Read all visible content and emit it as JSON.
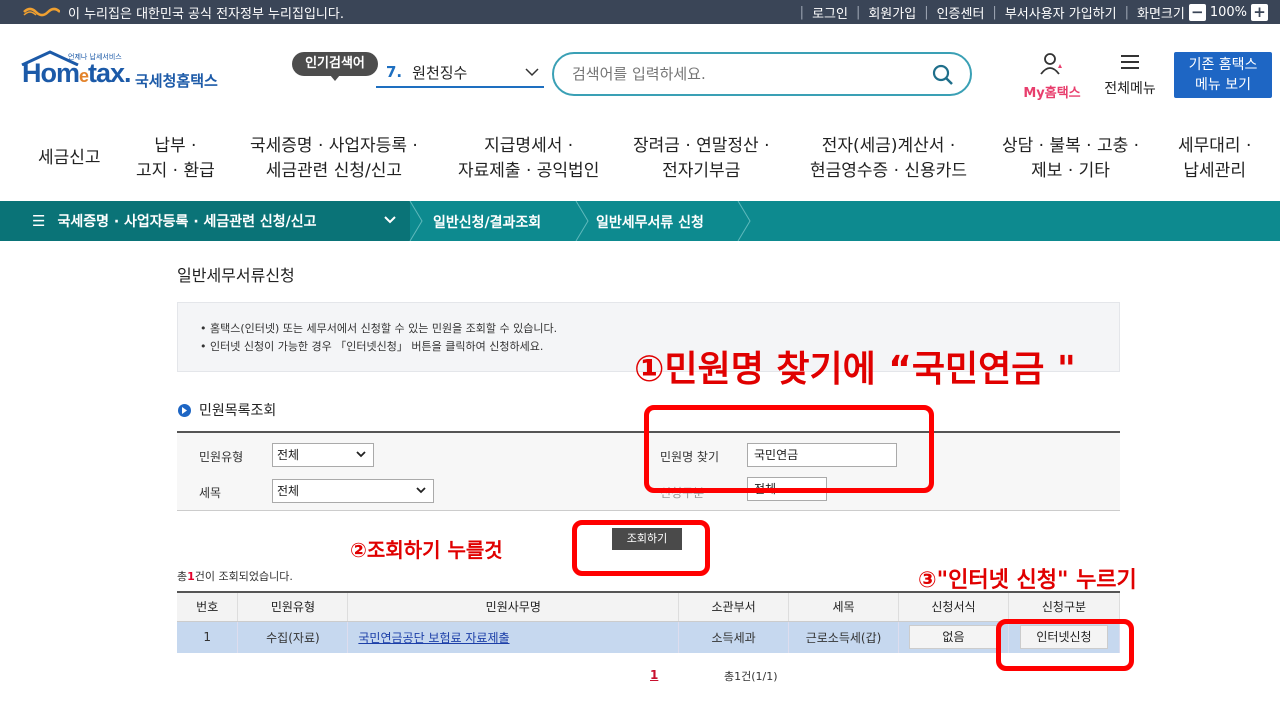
{
  "govbar": {
    "notice": "이 누리집은 대한민국 공식 전자정부 누리집입니다.",
    "links": [
      "로그인",
      "회원가입",
      "인증센터",
      "부서사용자 가입하기"
    ],
    "zoom_label": "화면크기",
    "zoom_value": "100%"
  },
  "header": {
    "logo_small": "언제나 납세서비스",
    "logo_home": "Hom",
    "logo_e": "e",
    "logo_tax": "tax.",
    "logo_nts": "국세청홈택스",
    "popular_badge": "인기검색어",
    "popular_num": "7.",
    "popular_term": "원천징수",
    "search_placeholder": "검색어를 입력하세요.",
    "my_hometax": "My홈택스",
    "all_menu": "전체메뉴",
    "old_menu_line1": "기존 홈택스",
    "old_menu_line2": "메뉴 보기"
  },
  "nav": [
    {
      "l1": "세금신고",
      "l2": ""
    },
    {
      "l1": "납부 ·",
      "l2": "고지 · 환급"
    },
    {
      "l1": "국세증명 · 사업자등록 ·",
      "l2": "세금관련 신청/신고"
    },
    {
      "l1": "지급명세서 ·",
      "l2": "자료제출 · 공익법인"
    },
    {
      "l1": "장려금 · 연말정산 ·",
      "l2": "전자기부금"
    },
    {
      "l1": "전자(세금)계산서 ·",
      "l2": "현금영수증 · 신용카드"
    },
    {
      "l1": "상담 · 불복 · 고충 ·",
      "l2": "제보 · 기타"
    },
    {
      "l1": "세무대리 ·",
      "l2": "납세관리"
    }
  ],
  "breadcrumb": {
    "c1": "국세증명 · 사업자등록 · 세금관련 신청/신고",
    "c2": "일반신청/결과조회",
    "c3": "일반세무서류 신청"
  },
  "content": {
    "title": "일반세무서류신청",
    "info1": "• 홈택스(인터넷) 또는 세무서에서 신청할 수 있는 민원을 조회할 수 있습니다.",
    "info2": "• 인터넷 신청이 가능한 경우 「인터넷신청」 버튼을 클릭하여 신청하세요.",
    "section": "민원목록조회",
    "filter": {
      "type_label": "민원유형",
      "type_value": "전체",
      "tax_label": "세목",
      "tax_value": "전체",
      "name_label": "민원명 찾기",
      "name_value": "국민연금",
      "apply_label": "신청구분",
      "apply_value": "전체"
    },
    "query_button": "조회하기",
    "total_prefix": "총",
    "total_count": "1",
    "total_suffix": "건이 조회되었습니다.",
    "table": {
      "headers": [
        "번호",
        "민원유형",
        "민원사무명",
        "소관부서",
        "세목",
        "신청서식",
        "신청구분"
      ],
      "row": {
        "no": "1",
        "type": "수집(자료)",
        "name": "국민연금공단 보험료 자료제출",
        "dept": "소득세과",
        "tax": "근로소득세(갑)",
        "form": "없음",
        "apply": "인터넷신청"
      }
    },
    "page_current": "1",
    "page_info": "총1건(1/1)"
  },
  "annotations": {
    "a1": "①민원명 찾기에 “국민연금 \"",
    "a2": "②조회하기  누를것",
    "a3": "③\"인터넷 신청\" 누르기"
  },
  "colors": {
    "govbar": "#3a4557",
    "breadcrumb": "#0d8a8f",
    "accent_blue": "#1e66c4",
    "annotation_red": "#ff0000"
  }
}
